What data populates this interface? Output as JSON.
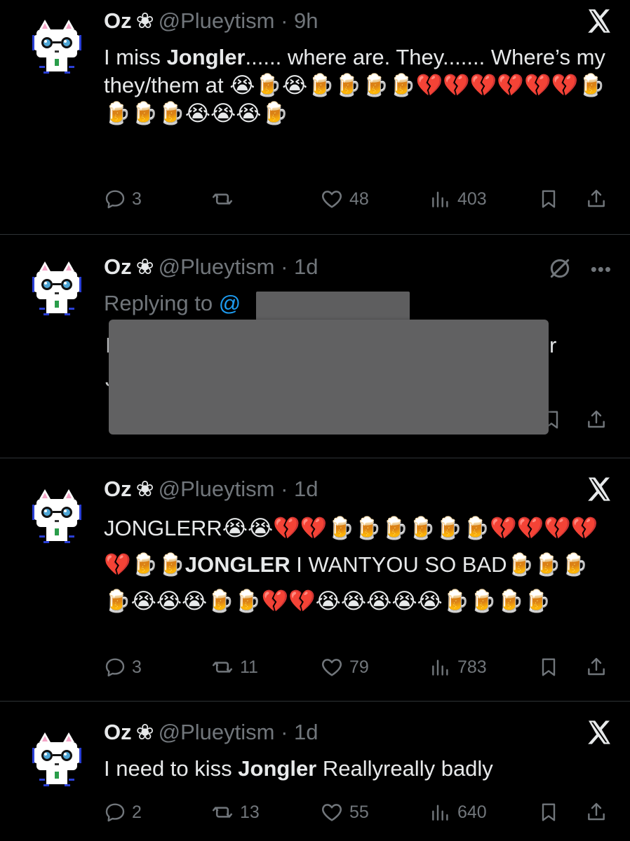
{
  "tweets": [
    {
      "name": "Oz",
      "flower": "❀",
      "handle": "@Plueytism",
      "time": "· 9h",
      "text_html": "I miss <b>Jongler</b>...... where are. They....... Where’s my they/them at 😭🍺😭🍺🍺🍺🍺💔💔💔💔💔💔🍺🍺🍺🍺😭😭😭🍺",
      "replies": "3",
      "reposts": "",
      "likes": "48",
      "views": "403"
    },
    {
      "name": "Oz",
      "flower": "❀",
      "handle": "@Plueytism",
      "time": "· 1d",
      "replying_to_label": "Replying to",
      "replying_to_mention": "@",
      "peek_left_top": "I",
      "peek_left_bottom": "J",
      "peek_right": "r"
    },
    {
      "name": "Oz",
      "flower": "❀",
      "handle": "@Plueytism",
      "time": "· 1d",
      "text_html": "JONGLERR😭😭💔💔🍺🍺🍺🍺🍺🍺💔💔💔💔💔🍺🍺<b>JONGLER</b> I WANTYOU SO BAD🍺🍺🍺🍺😭😭😭🍺🍺💔💔😭😭😭😭😭🍺🍺🍺🍺",
      "replies": "3",
      "reposts": "11",
      "likes": "79",
      "views": "783"
    },
    {
      "name": "Oz",
      "flower": "❀",
      "handle": "@Plueytism",
      "time": "· 1d",
      "text_html": "I need to kiss <b>Jongler</b> Reallyreally badly",
      "replies": "2",
      "reposts": "13",
      "likes": "55",
      "views": "640"
    }
  ],
  "icons": {
    "x_logo": "x-logo-icon",
    "grok": "slashed-circle-icon",
    "more": "more-dots-icon"
  },
  "colors": {
    "background": "#000000",
    "text": "#e7e9ea",
    "muted": "#71767b",
    "link": "#1d9bf0",
    "divider": "#2f3336"
  }
}
